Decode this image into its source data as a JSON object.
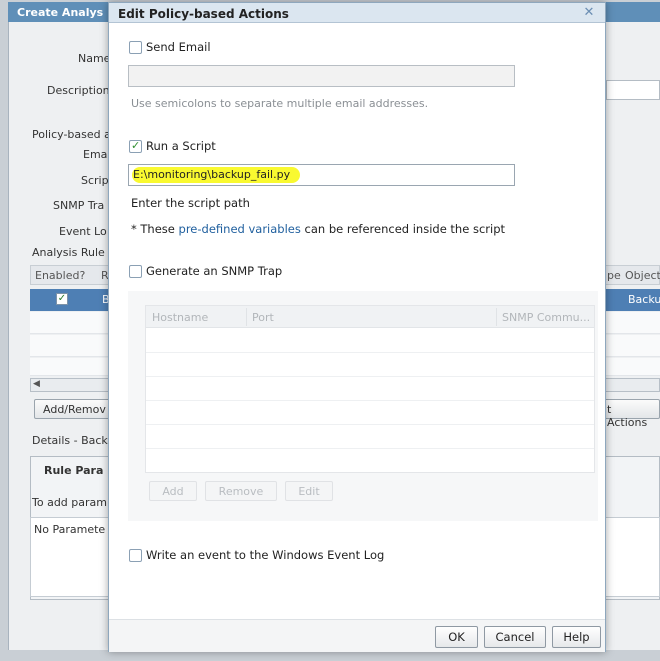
{
  "background": {
    "title": "Create Analys",
    "labels": {
      "name": "Name",
      "description": "Description",
      "policy_based": "Policy-based a",
      "email": "Ema",
      "script": "Scrip",
      "snmp_trap": "SNMP Tra",
      "event_log": "Event Lo",
      "analysis_rules": "Analysis Rule"
    },
    "table": {
      "col_enabled": "Enabled?",
      "col_r": "R",
      "col_pe": "pe",
      "col_object": "Object",
      "row_name_fragment": "B",
      "row_object_fragment": "Backu"
    },
    "add_remove_button": "Add/Remov",
    "actions_button": "t Actions",
    "details_title": "Details - Back",
    "rule_params_header": "Rule Para",
    "rule_params_hint": "To add param",
    "no_params": "No Paramete"
  },
  "dialog": {
    "title": "Edit Policy-based Actions",
    "close_icon": "close-x-icon",
    "send_email": {
      "label": "Send Email",
      "checked": false,
      "input_value": "",
      "hint": "Use semicolons to separate multiple email addresses."
    },
    "run_script": {
      "label": "Run a Script",
      "checked": true,
      "input_value": "E:\\monitoring\\backup_fail.py",
      "hint": "Enter the script path",
      "vars_prefix": "* These ",
      "vars_link": "pre-defined variables",
      "vars_suffix": " can be referenced inside the script"
    },
    "snmp": {
      "label": "Generate an SNMP Trap",
      "checked": false,
      "columns": [
        "Hostname",
        "Port",
        "SNMP Commu..."
      ],
      "rows": [],
      "buttons": {
        "add": "Add",
        "remove": "Remove",
        "edit": "Edit"
      }
    },
    "event_log": {
      "label": "Write an event to the Windows Event Log",
      "checked": false
    },
    "buttons": {
      "ok": "OK",
      "cancel": "Cancel",
      "help": "Help"
    }
  },
  "colors": {
    "title_bar_bg": "#5f8fb8",
    "dialog_title_bg": "#dbe6f0",
    "link": "#1f5f9e",
    "highlight": "#f9f930",
    "selected_row": "#4e7fb4",
    "check": "#2f8f2f"
  }
}
